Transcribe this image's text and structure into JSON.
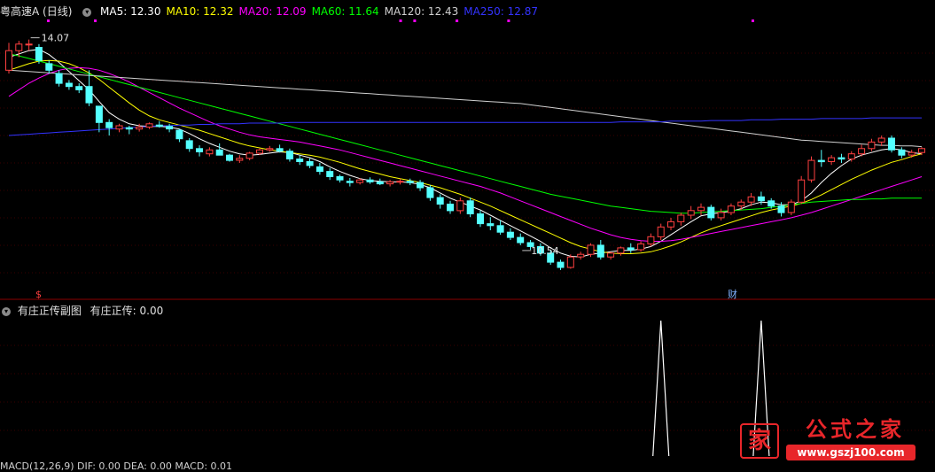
{
  "header": {
    "title": "粤高速A (日线)",
    "ma": [
      {
        "label": "MA5: 12.30",
        "color": "#ffffff"
      },
      {
        "label": "MA10: 12.32",
        "color": "#ffff00"
      },
      {
        "label": "MA20: 12.09",
        "color": "#ff00ff"
      },
      {
        "label": "MA60: 11.64",
        "color": "#00ff00"
      },
      {
        "label": "MA120: 12.43",
        "color": "#d0d0d0"
      },
      {
        "label": "MA250: 12.87",
        "color": "#3333ff"
      }
    ]
  },
  "sub_panel": {
    "title": "有庄正传副图",
    "indicator": "有庄正传: 0.00"
  },
  "bottom_panel": {
    "text": "MACD(12,26,9) DIF: 0.00 DEA: 0.00 MACD: 0.01"
  },
  "watermark": {
    "brand": "公式之家",
    "url": "www.gszj100.com",
    "logo": "家",
    "diagonal": "公式之家 www.gszj100.com"
  },
  "colors": {
    "up": "#ff4040",
    "down": "#54ffff",
    "ma5": "#ffffff",
    "ma10": "#ffff00",
    "ma20": "#ff00ff",
    "ma60": "#00ff00",
    "ma120": "#d0d0d0",
    "ma250": "#3333ff",
    "grid": "#3a0000"
  },
  "chart_data": {
    "type": "candlestick",
    "y_range": [
      10.2,
      14.35
    ],
    "annotations": [
      {
        "text": "14.07",
        "type": "high",
        "index": 2
      },
      {
        "text": "10.54",
        "type": "low",
        "index": 51
      },
      {
        "text": "财",
        "type": "marker",
        "index": 72
      },
      {
        "text": "$",
        "type": "marker",
        "index": 3
      }
    ],
    "ohlc": [
      [
        13.6,
        14.02,
        13.55,
        13.9
      ],
      [
        13.9,
        14.05,
        13.8,
        14.0
      ],
      [
        14.0,
        14.07,
        13.9,
        14.0
      ],
      [
        13.95,
        14.0,
        13.7,
        13.75
      ],
      [
        13.7,
        13.75,
        13.55,
        13.6
      ],
      [
        13.55,
        13.6,
        13.35,
        13.4
      ],
      [
        13.4,
        13.45,
        13.3,
        13.35
      ],
      [
        13.35,
        13.4,
        13.25,
        13.3
      ],
      [
        13.35,
        13.6,
        13.05,
        13.1
      ],
      [
        13.05,
        13.05,
        12.65,
        12.8
      ],
      [
        12.8,
        12.85,
        12.6,
        12.72
      ],
      [
        12.7,
        12.78,
        12.65,
        12.75
      ],
      [
        12.72,
        12.75,
        12.62,
        12.7
      ],
      [
        12.7,
        12.78,
        12.66,
        12.73
      ],
      [
        12.73,
        12.8,
        12.7,
        12.78
      ],
      [
        12.76,
        12.82,
        12.72,
        12.74
      ],
      [
        12.74,
        12.78,
        12.65,
        12.7
      ],
      [
        12.68,
        12.7,
        12.5,
        12.55
      ],
      [
        12.52,
        12.56,
        12.35,
        12.4
      ],
      [
        12.4,
        12.45,
        12.28,
        12.35
      ],
      [
        12.32,
        12.42,
        12.28,
        12.38
      ],
      [
        12.38,
        12.48,
        12.3,
        12.3
      ],
      [
        12.3,
        12.32,
        12.2,
        12.22
      ],
      [
        12.22,
        12.3,
        12.18,
        12.25
      ],
      [
        12.25,
        12.35,
        12.22,
        12.33
      ],
      [
        12.33,
        12.4,
        12.3,
        12.38
      ],
      [
        12.38,
        12.44,
        12.35,
        12.4
      ],
      [
        12.4,
        12.46,
        12.34,
        12.36
      ],
      [
        12.36,
        12.4,
        12.2,
        12.24
      ],
      [
        12.24,
        12.3,
        12.15,
        12.2
      ],
      [
        12.2,
        12.25,
        12.1,
        12.14
      ],
      [
        12.12,
        12.18,
        12.0,
        12.05
      ],
      [
        12.05,
        12.1,
        11.92,
        11.97
      ],
      [
        11.97,
        12.0,
        11.88,
        11.92
      ],
      [
        11.9,
        11.95,
        11.82,
        11.88
      ],
      [
        11.88,
        11.95,
        11.85,
        11.92
      ],
      [
        11.92,
        11.96,
        11.86,
        11.89
      ],
      [
        11.89,
        11.94,
        11.84,
        11.86
      ],
      [
        11.86,
        11.92,
        11.82,
        11.89
      ],
      [
        11.89,
        11.94,
        11.85,
        11.9
      ],
      [
        11.9,
        11.94,
        11.84,
        11.88
      ],
      [
        11.88,
        11.92,
        11.75,
        11.8
      ],
      [
        11.8,
        11.84,
        11.6,
        11.65
      ],
      [
        11.65,
        11.7,
        11.48,
        11.55
      ],
      [
        11.55,
        11.6,
        11.4,
        11.45
      ],
      [
        11.45,
        11.65,
        11.4,
        11.6
      ],
      [
        11.6,
        11.65,
        11.35,
        11.4
      ],
      [
        11.4,
        11.45,
        11.2,
        11.25
      ],
      [
        11.25,
        11.35,
        11.15,
        11.22
      ],
      [
        11.22,
        11.3,
        11.08,
        11.12
      ],
      [
        11.12,
        11.18,
        11.0,
        11.04
      ],
      [
        11.04,
        11.1,
        10.92,
        10.96
      ],
      [
        10.96,
        11.0,
        10.85,
        10.9
      ],
      [
        10.9,
        10.95,
        10.76,
        10.8
      ],
      [
        10.8,
        10.84,
        10.62,
        10.66
      ],
      [
        10.66,
        10.7,
        10.54,
        10.58
      ],
      [
        10.58,
        10.78,
        10.56,
        10.74
      ],
      [
        10.74,
        10.82,
        10.7,
        10.78
      ],
      [
        10.78,
        10.95,
        10.74,
        10.92
      ],
      [
        10.92,
        11.0,
        10.7,
        10.74
      ],
      [
        10.74,
        10.82,
        10.7,
        10.8
      ],
      [
        10.8,
        10.9,
        10.76,
        10.88
      ],
      [
        10.88,
        10.95,
        10.8,
        10.85
      ],
      [
        10.85,
        10.98,
        10.82,
        10.94
      ],
      [
        10.94,
        11.1,
        10.9,
        11.05
      ],
      [
        11.05,
        11.25,
        11.0,
        11.2
      ],
      [
        11.2,
        11.34,
        11.15,
        11.28
      ],
      [
        11.28,
        11.42,
        11.22,
        11.38
      ],
      [
        11.38,
        11.52,
        11.32,
        11.45
      ],
      [
        11.45,
        11.56,
        11.38,
        11.5
      ],
      [
        11.5,
        11.54,
        11.3,
        11.34
      ],
      [
        11.34,
        11.48,
        11.3,
        11.42
      ],
      [
        11.42,
        11.56,
        11.38,
        11.52
      ],
      [
        11.52,
        11.62,
        11.46,
        11.58
      ],
      [
        11.58,
        11.72,
        11.52,
        11.66
      ],
      [
        11.66,
        11.74,
        11.54,
        11.6
      ],
      [
        11.6,
        11.64,
        11.48,
        11.52
      ],
      [
        11.52,
        11.58,
        11.36,
        11.42
      ],
      [
        11.42,
        11.62,
        11.38,
        11.58
      ],
      [
        11.58,
        11.98,
        11.55,
        11.92
      ],
      [
        11.92,
        12.28,
        11.88,
        12.22
      ],
      [
        12.22,
        12.38,
        12.12,
        12.2
      ],
      [
        12.2,
        12.3,
        12.15,
        12.26
      ],
      [
        12.26,
        12.32,
        12.18,
        12.24
      ],
      [
        12.24,
        12.36,
        12.2,
        12.32
      ],
      [
        12.32,
        12.46,
        12.28,
        12.4
      ],
      [
        12.4,
        12.55,
        12.36,
        12.5
      ],
      [
        12.5,
        12.6,
        12.44,
        12.56
      ],
      [
        12.56,
        12.6,
        12.34,
        12.38
      ],
      [
        12.38,
        12.42,
        12.25,
        12.3
      ],
      [
        12.3,
        12.38,
        12.26,
        12.34
      ],
      [
        12.34,
        12.42,
        12.3,
        12.4
      ]
    ],
    "ma_lines": {
      "MA5": [
        13.8,
        13.85,
        13.9,
        13.92,
        13.84,
        13.72,
        13.58,
        13.44,
        13.3,
        13.12,
        12.95,
        12.85,
        12.78,
        12.75,
        12.74,
        12.74,
        12.73,
        12.7,
        12.63,
        12.55,
        12.48,
        12.42,
        12.36,
        12.32,
        12.3,
        12.31,
        12.33,
        12.35,
        12.34,
        12.3,
        12.26,
        12.2,
        12.12,
        12.05,
        11.99,
        11.94,
        11.91,
        11.9,
        11.89,
        11.89,
        11.88,
        11.85,
        11.8,
        11.72,
        11.64,
        11.58,
        11.52,
        11.46,
        11.38,
        11.3,
        11.22,
        11.14,
        11.06,
        10.98,
        10.88,
        10.8,
        10.75,
        10.74,
        10.78,
        10.8,
        10.82,
        10.84,
        10.84,
        10.86,
        10.9,
        10.98,
        11.08,
        11.18,
        11.28,
        11.37,
        11.4,
        11.42,
        11.44,
        11.48,
        11.54,
        11.58,
        11.57,
        11.54,
        11.54,
        11.6,
        11.72,
        11.88,
        12.02,
        12.14,
        12.24,
        12.3,
        12.34,
        12.38,
        12.4,
        12.38,
        12.34,
        12.32
      ],
      "MA10": [
        13.6,
        13.65,
        13.7,
        13.74,
        13.75,
        13.74,
        13.7,
        13.64,
        13.56,
        13.46,
        13.34,
        13.22,
        13.1,
        12.99,
        12.9,
        12.84,
        12.8,
        12.76,
        12.72,
        12.68,
        12.63,
        12.58,
        12.53,
        12.48,
        12.44,
        12.41,
        12.38,
        12.36,
        12.34,
        12.32,
        12.3,
        12.27,
        12.23,
        12.19,
        12.14,
        12.09,
        12.05,
        12.01,
        11.97,
        11.94,
        11.91,
        11.88,
        11.84,
        11.8,
        11.75,
        11.7,
        11.64,
        11.58,
        11.52,
        11.45,
        11.38,
        11.31,
        11.24,
        11.17,
        11.1,
        11.03,
        10.96,
        10.9,
        10.86,
        10.82,
        10.8,
        10.79,
        10.79,
        10.8,
        10.82,
        10.86,
        10.91,
        10.97,
        11.04,
        11.11,
        11.17,
        11.22,
        11.27,
        11.32,
        11.37,
        11.42,
        11.46,
        11.49,
        11.52,
        11.56,
        11.62,
        11.69,
        11.77,
        11.85,
        11.93,
        12.0,
        12.07,
        12.13,
        12.19,
        12.23,
        12.28,
        12.32
      ],
      "MA20": [
        13.2,
        13.3,
        13.4,
        13.48,
        13.55,
        13.6,
        13.63,
        13.64,
        13.63,
        13.6,
        13.55,
        13.49,
        13.42,
        13.34,
        13.26,
        13.18,
        13.1,
        13.02,
        12.95,
        12.88,
        12.81,
        12.75,
        12.7,
        12.65,
        12.61,
        12.58,
        12.56,
        12.54,
        12.52,
        12.5,
        12.47,
        12.44,
        12.41,
        12.38,
        12.34,
        12.3,
        12.26,
        12.22,
        12.18,
        12.14,
        12.1,
        12.06,
        12.02,
        11.98,
        11.94,
        11.9,
        11.86,
        11.82,
        11.77,
        11.72,
        11.66,
        11.6,
        11.54,
        11.48,
        11.42,
        11.36,
        11.3,
        11.24,
        11.18,
        11.13,
        11.08,
        11.04,
        11.01,
        10.99,
        10.98,
        10.98,
        10.99,
        11.01,
        11.04,
        11.07,
        11.1,
        11.13,
        11.16,
        11.19,
        11.22,
        11.25,
        11.28,
        11.31,
        11.34,
        11.38,
        11.42,
        11.47,
        11.52,
        11.57,
        11.62,
        11.67,
        11.72,
        11.77,
        11.82,
        11.87,
        11.92,
        11.97
      ],
      "MA60": [
        13.85,
        13.82,
        13.78,
        13.74,
        13.7,
        13.66,
        13.62,
        13.58,
        13.54,
        13.5,
        13.46,
        13.42,
        13.38,
        13.34,
        13.3,
        13.26,
        13.22,
        13.18,
        13.14,
        13.1,
        13.06,
        13.02,
        12.98,
        12.94,
        12.9,
        12.86,
        12.82,
        12.78,
        12.74,
        12.7,
        12.66,
        12.62,
        12.58,
        12.54,
        12.5,
        12.46,
        12.42,
        12.38,
        12.34,
        12.3,
        12.26,
        12.22,
        12.18,
        12.14,
        12.1,
        12.06,
        12.02,
        11.98,
        11.94,
        11.9,
        11.86,
        11.82,
        11.78,
        11.74,
        11.7,
        11.67,
        11.64,
        11.61,
        11.58,
        11.55,
        11.52,
        11.5,
        11.48,
        11.46,
        11.44,
        11.43,
        11.42,
        11.41,
        11.41,
        11.42,
        11.43,
        11.44,
        11.45,
        11.46,
        11.47,
        11.48,
        11.5,
        11.52,
        11.54,
        11.56,
        11.58,
        11.59,
        11.6,
        11.61,
        11.62,
        11.62,
        11.63,
        11.63,
        11.64,
        11.64,
        11.64,
        11.64
      ],
      "MA120": [
        13.6,
        13.59,
        13.58,
        13.57,
        13.56,
        13.55,
        13.54,
        13.53,
        13.52,
        13.51,
        13.5,
        13.49,
        13.48,
        13.47,
        13.46,
        13.45,
        13.44,
        13.43,
        13.42,
        13.41,
        13.4,
        13.39,
        13.38,
        13.37,
        13.36,
        13.35,
        13.34,
        13.33,
        13.32,
        13.31,
        13.3,
        13.29,
        13.28,
        13.27,
        13.26,
        13.25,
        13.24,
        13.23,
        13.22,
        13.21,
        13.2,
        13.19,
        13.18,
        13.17,
        13.16,
        13.15,
        13.14,
        13.13,
        13.12,
        13.11,
        13.1,
        13.09,
        13.07,
        13.05,
        13.03,
        13.01,
        12.99,
        12.97,
        12.95,
        12.93,
        12.91,
        12.89,
        12.87,
        12.85,
        12.83,
        12.81,
        12.79,
        12.77,
        12.75,
        12.73,
        12.71,
        12.69,
        12.67,
        12.65,
        12.63,
        12.61,
        12.59,
        12.57,
        12.55,
        12.53,
        12.52,
        12.51,
        12.5,
        12.49,
        12.48,
        12.47,
        12.46,
        12.45,
        12.45,
        12.44,
        12.44,
        12.43
      ],
      "MA250": [
        12.6,
        12.61,
        12.62,
        12.63,
        12.64,
        12.65,
        12.66,
        12.67,
        12.68,
        12.69,
        12.7,
        12.71,
        12.72,
        12.73,
        12.74,
        12.75,
        12.75,
        12.76,
        12.76,
        12.77,
        12.77,
        12.78,
        12.78,
        12.78,
        12.79,
        12.79,
        12.79,
        12.79,
        12.8,
        12.8,
        12.8,
        12.8,
        12.8,
        12.8,
        12.8,
        12.8,
        12.8,
        12.8,
        12.8,
        12.8,
        12.8,
        12.8,
        12.8,
        12.8,
        12.8,
        12.8,
        12.8,
        12.8,
        12.8,
        12.8,
        12.8,
        12.8,
        12.8,
        12.8,
        12.8,
        12.8,
        12.8,
        12.8,
        12.8,
        12.8,
        12.8,
        12.81,
        12.81,
        12.81,
        12.81,
        12.81,
        12.82,
        12.82,
        12.82,
        12.82,
        12.83,
        12.83,
        12.83,
        12.83,
        12.84,
        12.84,
        12.84,
        12.85,
        12.85,
        12.85,
        12.85,
        12.86,
        12.86,
        12.86,
        12.86,
        12.86,
        12.87,
        12.87,
        12.87,
        12.87,
        12.87,
        12.87
      ]
    },
    "sub_indicator": {
      "name": "有庄正传",
      "spikes": [
        65,
        75
      ],
      "y_range": [
        0,
        1
      ]
    }
  }
}
